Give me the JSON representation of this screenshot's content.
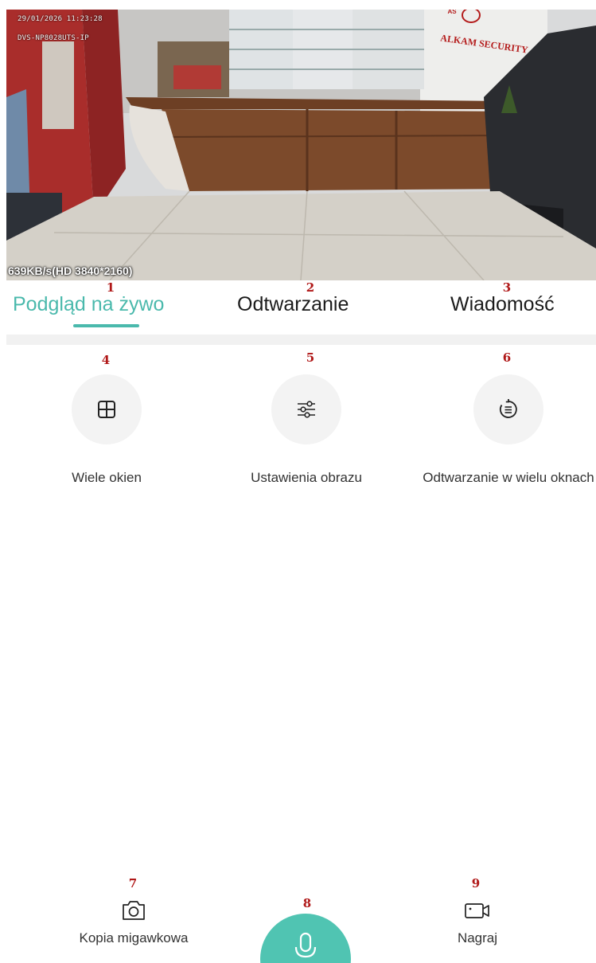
{
  "video": {
    "timestamp": "29/01/2026 11:23:28",
    "channel_name": "DVS-NP8028UTS-IP",
    "bitrate": "639KB/s(HD 3840*2160)",
    "sign_text": "ALKAM SECURITY",
    "sign_logo": "AS"
  },
  "annotations": [
    "1",
    "2",
    "3",
    "4",
    "5",
    "6",
    "7",
    "8",
    "9"
  ],
  "tabs": [
    {
      "label": "Podgląd na żywo",
      "active": true
    },
    {
      "label": "Odtwarzanie",
      "active": false
    },
    {
      "label": "Wiadomość",
      "active": false
    }
  ],
  "tools": [
    {
      "label": "Wiele okien",
      "icon": "grid-icon"
    },
    {
      "label": "Ustawienia obrazu",
      "icon": "sliders-icon"
    },
    {
      "label": "Odtwarzanie w wielu oknach",
      "icon": "replay-list-icon"
    }
  ],
  "bottom": {
    "snapshot_label": "Kopia migawkowa",
    "record_label": "Nagraj",
    "snapshot_icon": "camera-icon",
    "talk_icon": "microphone-icon",
    "record_icon": "video-camera-icon"
  },
  "colors": {
    "accent": "#4ab9ac",
    "mic_button": "#50c4b2",
    "annotation": "#b01818"
  }
}
